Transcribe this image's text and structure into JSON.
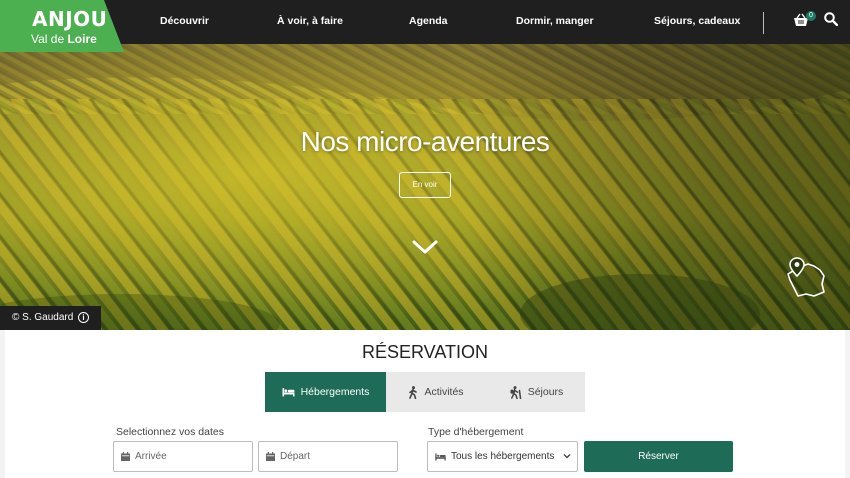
{
  "brand": {
    "name": "ANJOU",
    "subtitle_prefix": "Val de ",
    "subtitle_bold": "Loire",
    "color": "#4caf50"
  },
  "nav": {
    "items": [
      {
        "label": "Découvrir"
      },
      {
        "label": "À voir, à faire"
      },
      {
        "label": "Agenda"
      },
      {
        "label": "Dormir, manger"
      },
      {
        "label": "Séjours, cadeaux"
      }
    ],
    "cart_count": "0"
  },
  "hero": {
    "title": "Nos micro-aventures",
    "button_label": "En voir",
    "credit": "© S. Gaudard",
    "credit_icon": "i"
  },
  "reservation": {
    "title": "RÉSERVATION",
    "tabs": [
      {
        "label": "Hébergements",
        "icon": "bed-icon",
        "active": true
      },
      {
        "label": "Activités",
        "icon": "walker-icon",
        "active": false
      },
      {
        "label": "Séjours",
        "icon": "hiker-icon",
        "active": false
      }
    ],
    "dates_label": "Selectionnez vos dates",
    "arrival_placeholder": "Arrivée",
    "departure_placeholder": "Départ",
    "type_label": "Type d'hébergement",
    "type_selected": "Tous les hébergements",
    "submit_label": "Réserver",
    "accent": "#1e6b57"
  }
}
